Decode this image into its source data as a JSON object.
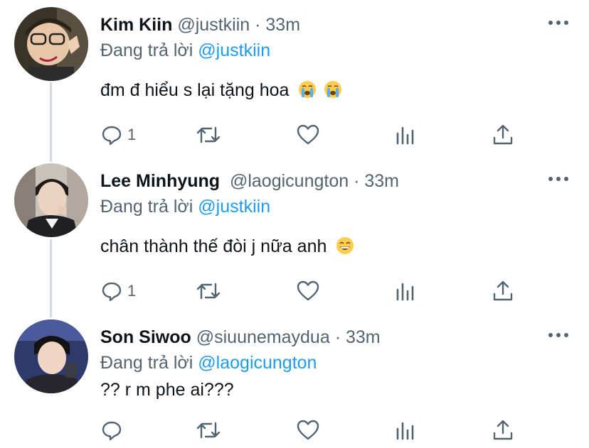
{
  "tweets": [
    {
      "name": "Kim Kiin",
      "handle": "@justkiin",
      "separator": "·",
      "time": "33m",
      "replying_prefix": "Đang trả lời",
      "replying_to": "@justkiin",
      "text": "đm đ hiểu s lại tặng hoa",
      "emojis": [
        "loudly-crying-face",
        "loudly-crying-face"
      ],
      "reply_count": "1",
      "avatar_bg": "#3a3428"
    },
    {
      "name": "Lee Minhyung",
      "handle": "@laogicungton",
      "separator": "·",
      "time": "33m",
      "replying_prefix": "Đang trả lời",
      "replying_to": "@justkiin",
      "text": "chân thành thế đòi j nữa anh",
      "emojis": [
        "grinning-face-with-smiling-eyes"
      ],
      "reply_count": "1",
      "avatar_bg": "#c9c2bb"
    },
    {
      "name": "Son Siwoo",
      "handle": "@siuunemaydua",
      "separator": "·",
      "time": "33m",
      "replying_prefix": "Đang trả lời",
      "replying_to": "@laogicungton",
      "text": "?? r m phe ai???",
      "emojis": [],
      "reply_count": "",
      "avatar_bg": "#2d3a6b"
    }
  ],
  "icons": {
    "reply": "reply-icon",
    "retweet": "retweet-icon",
    "like": "heart-icon",
    "analytics": "analytics-icon",
    "share": "share-icon",
    "more": "more-icon"
  },
  "colors": {
    "text": "#0f1419",
    "secondary": "#536471",
    "link": "#1d9bf0",
    "thread_line": "#cfd9de"
  }
}
